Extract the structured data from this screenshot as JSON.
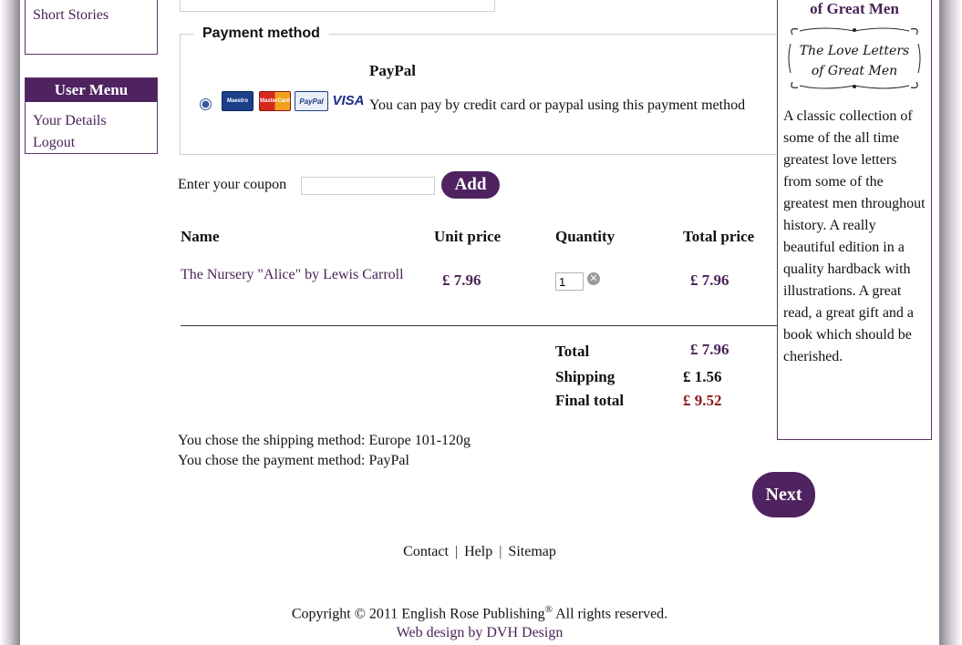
{
  "sidebar": {
    "categories_partial_link": "Short Stories",
    "user_menu": {
      "title": "User Menu",
      "items": [
        "Your Details",
        "Logout"
      ]
    }
  },
  "payment": {
    "legend": "Payment method",
    "option_title": "PayPal",
    "option_desc": "You can pay by credit card or paypal using this payment method",
    "cards": [
      "Maestro",
      "MasterCard",
      "PayPal",
      "VISA"
    ]
  },
  "coupon": {
    "label": "Enter your coupon",
    "value": "",
    "button": "Add"
  },
  "cart": {
    "headers": [
      "Name",
      "Unit price",
      "Quantity",
      "Total price"
    ],
    "items": [
      {
        "name": "The Nursery \"Alice\" by Lewis Carroll",
        "unit_price": "£ 7.96",
        "quantity": "1",
        "total_price": "£ 7.96"
      }
    ],
    "totals": {
      "total_label": "Total",
      "total_value": "£ 7.96",
      "shipping_label": "Shipping",
      "shipping_value": "£ 1.56",
      "final_label": "Final total",
      "final_value": "£ 9.52"
    }
  },
  "chosen": {
    "shipping": "You chose the shipping method: Europe 101-120g",
    "payment": "You chose the payment method: PayPal"
  },
  "next_button": "Next",
  "promo": {
    "title": "of Great Men",
    "image_text_1": "The Love Letters",
    "image_text_2": "of Great Men",
    "description": "A classic collection of some of the all time greatest love letters from some of the greatest men throughout history. A really beautiful edition in a quality hardback with illustrations. A great read, a great gift and a book which should be cherished."
  },
  "footer": {
    "links": [
      "Contact",
      "Help",
      "Sitemap"
    ],
    "separator": "|",
    "copyright_prefix": "Copyright © 2011 English Rose Publishing",
    "copyright_reg": "®",
    "copyright_suffix": " All rights reserved.",
    "credit": "Web design by DVH Design"
  },
  "colors": {
    "brand": "#4f2260",
    "final_total": "#8b1a1a"
  }
}
